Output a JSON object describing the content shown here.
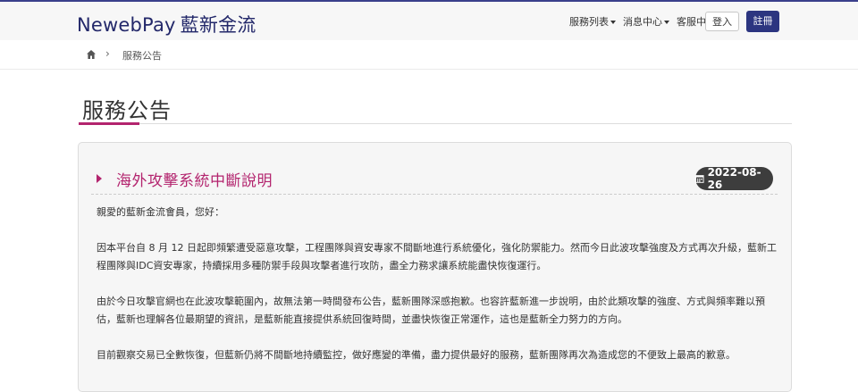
{
  "header": {
    "logo_text": "NewebPay",
    "logo_cn": "藍新金流",
    "nav": [
      {
        "label": "服務列表"
      },
      {
        "label": "消息中心"
      },
      {
        "label": "客服中心"
      }
    ],
    "login_label": "登入",
    "register_label": "註冊",
    "accent_color": "#2c3580"
  },
  "breadcrumb": {
    "home_icon": "home-icon",
    "current": "服務公告"
  },
  "page": {
    "title": "服務公告",
    "accent_color": "#b3246e"
  },
  "notice": {
    "title": "海外攻擊系統中斷說明",
    "date": "2022-08-26",
    "date_icon": "calendar-icon",
    "paragraphs": [
      "親愛的藍新金流會員，您好：",
      "因本平台自 8 月 12 日起即頻繁遭受惡意攻擊，工程團隊與資安專家不間斷地進行系統優化，強化防禦能力。然而今日此波攻擊強度及方式再次升級，藍新工",
      "程團隊與IDC資安專家，持續採用多種防禦手段與攻擊者進行攻防，盡全力務求讓系統能盡快恢復運行。",
      "由於今日攻擊官網也在此波攻擊範圍內，故無法第一時間發布公告，藍新團隊深感抱歉。也容許藍新進一步說明，由於此類攻擊的強度、方式與頻率難以預",
      "估，藍新也理解各位最期望的資訊，是藍新能直接提供系統回復時間，並盡快恢復正常運作，這也是藍新全力努力的方向。",
      "目前觀察交易已全數恢復，但藍新仍將不間斷地持續監控，做好應變的準備，盡力提供最好的服務，藍新團隊再次為造成您的不便致上最高的歉意。"
    ]
  }
}
